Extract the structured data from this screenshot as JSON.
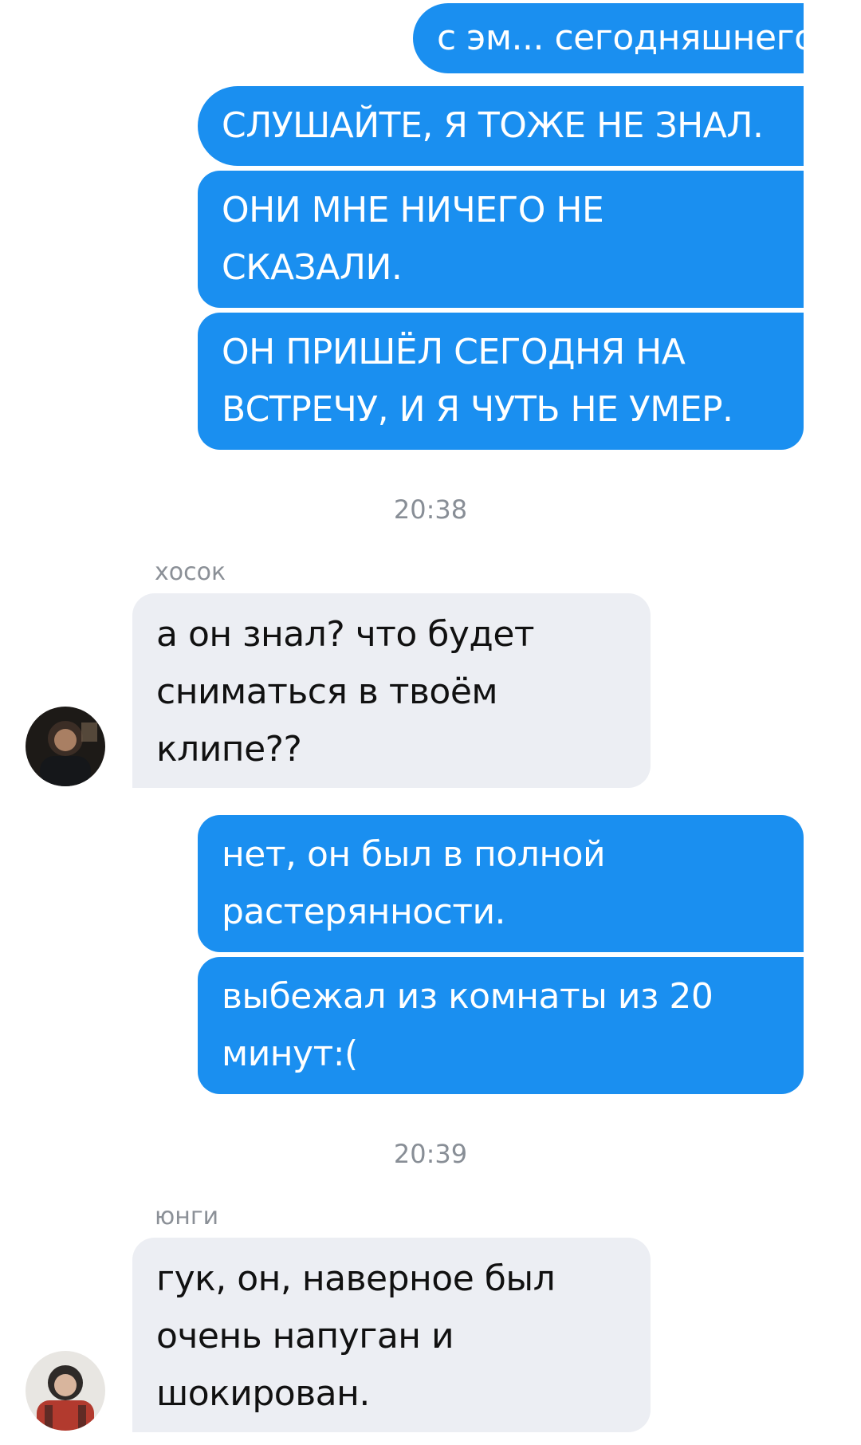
{
  "messages": {
    "out1": "с эм... сегодняшнего?",
    "out2": "СЛУШАЙТЕ, Я ТОЖЕ НЕ ЗНАЛ.",
    "out3": "ОНИ МНЕ НИЧЕГО НЕ СКАЗАЛИ.",
    "out4": "ОН ПРИШЁЛ СЕГОДНЯ НА ВСТРЕЧУ, И Я ЧУТЬ НЕ УМЕР.",
    "time1": "20:38",
    "sender1": "хосок",
    "in1": "а он знал? что будет сниматься в твоём клипе??",
    "out5": "нет, он был в полной растерянности.",
    "out6": "выбежал из комнаты из 20 минут:(",
    "time2": "20:39",
    "sender2": "юнги",
    "in2": "гук, он, наверное был очень напуган и шокирован."
  },
  "colors": {
    "outgoing": "#1a8ff0",
    "incoming": "#eceef3",
    "meta_text": "#888e96"
  },
  "icons": {
    "avatar1": "avatar-hoseok",
    "avatar2": "avatar-yoongi"
  }
}
